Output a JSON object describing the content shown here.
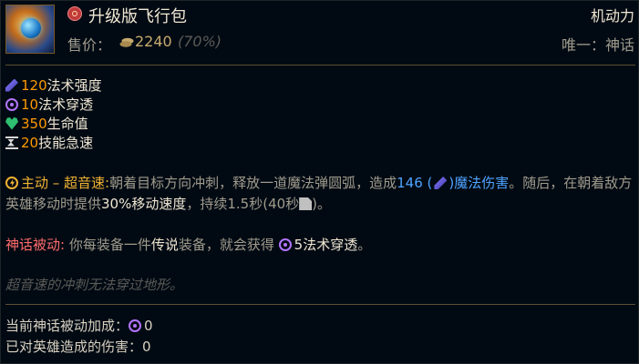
{
  "item": {
    "name": "升级版飞行包",
    "category": "机动力",
    "price_label": "售价：",
    "price_value": "2240",
    "price_percent": "(70%)",
    "uniqueness": "唯一：神话"
  },
  "stats": [
    {
      "value": "120",
      "label": "法术强度",
      "icon": "ability-power-icon"
    },
    {
      "value": "10",
      "label": "法术穿透",
      "icon": "magic-penetration-icon"
    },
    {
      "value": "350",
      "label": "生命值",
      "icon": "health-icon"
    },
    {
      "value": "20",
      "label": "技能急速",
      "icon": "ability-haste-icon"
    }
  ],
  "active": {
    "name": "主动 – 超音速:",
    "text1": "朝着目标方向冲刺，释放一道魔法弹圆弧，造成",
    "damage": "146",
    "open_paren": "(",
    "close_paren": ")",
    "magic_damage": "魔法伤害",
    "text2": "。随后，在朝着敌方英雄移动时提供",
    "movespeed": "30%移动速度",
    "text3": "，持续1.5秒(40秒",
    "text4": ")。"
  },
  "mythic_passive": {
    "label": "神话被动:",
    "text1": "你每装备一件",
    "legendary": "传说",
    "text2": "装备，就会获得",
    "value": "5法术穿透",
    "text3": "。"
  },
  "flavor_text": "超音速的冲刺无法穿过地形。",
  "footer": {
    "bonus_label": "当前神话被动加成：",
    "bonus_value": "0",
    "damage_label": "已对英雄造成的伤害：",
    "damage_value": "0"
  },
  "colors": {
    "background": "#010a13",
    "gold": "#c8aa6e",
    "stat_value": "#ff9900",
    "ability_power": "#4fa3ff",
    "active": "#f0b232",
    "mythic": "#ff6b6b"
  }
}
